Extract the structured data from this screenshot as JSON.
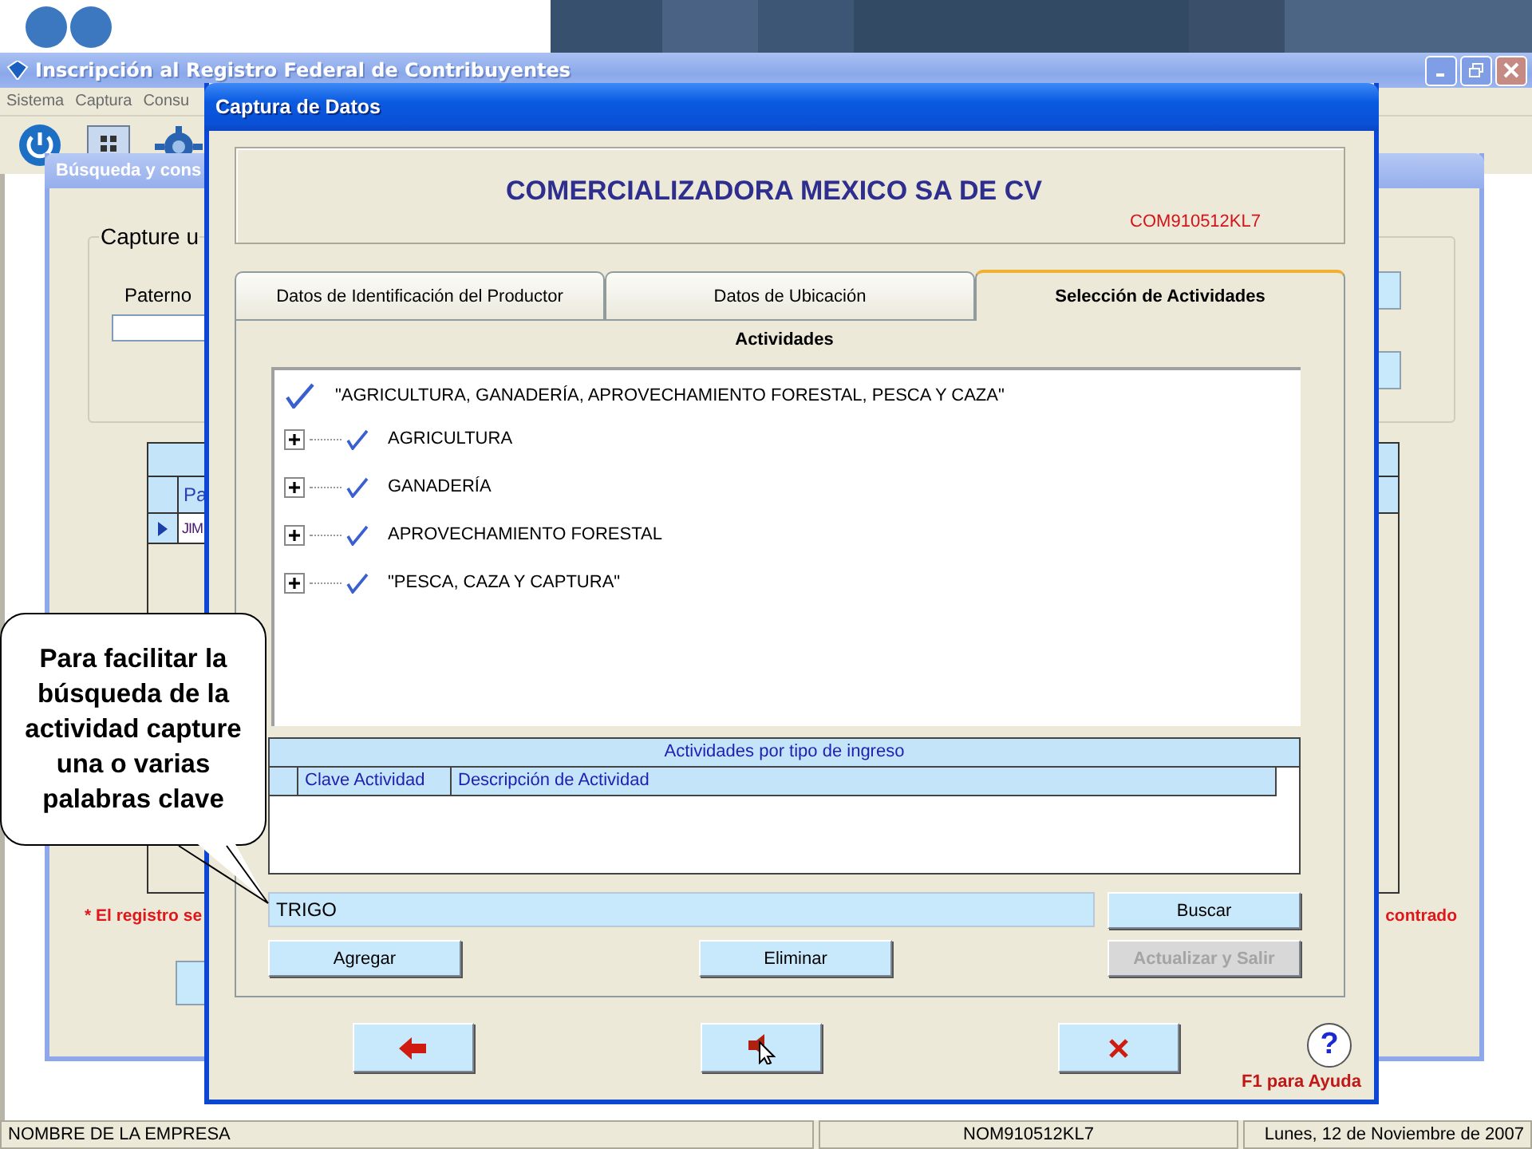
{
  "banner": {
    "kind": "logo"
  },
  "main_window": {
    "title": "Inscripción al Registro Federal de Contribuyentes",
    "menu": [
      "Sistema",
      "Captura",
      "Consu"
    ],
    "status_bar": [
      "NOMBRE DE LA EMPRESA",
      "NOM910512KL7",
      "Lunes, 12 de Noviembre de 2007"
    ]
  },
  "search_dialog": {
    "title": "Búsqueda y cons",
    "group_label": "Capture u",
    "field_label": "Paterno",
    "grid_header": "Pa",
    "grid_rows": [
      {
        "text": "JIM",
        "selected": true
      }
    ],
    "note": "* El registro se",
    "note_end": "contrado"
  },
  "capture_dialog": {
    "title": "Captura de Datos",
    "company_name": "COMERCIALIZADORA MEXICO SA DE CV",
    "rfc": "COM910512KL7",
    "tabs": [
      {
        "label": "Datos de Identificación del Productor",
        "selected": false
      },
      {
        "label": "Datos de Ubicación",
        "selected": false
      },
      {
        "label": "Selección de Actividades",
        "selected": true
      }
    ],
    "section_title": "Actividades",
    "tree": [
      {
        "label": "\"AGRICULTURA, GANADERÍA, APROVECHAMIENTO FORESTAL, PESCA Y CAZA\"",
        "checked": true,
        "children": [
          {
            "label": "AGRICULTURA",
            "checked": true,
            "expanded": false
          },
          {
            "label": "GANADERÍA",
            "checked": true,
            "expanded": false
          },
          {
            "label": "APROVECHAMIENTO FORESTAL",
            "checked": true,
            "expanded": false
          },
          {
            "label": "\"PESCA, CAZA Y CAPTURA\"",
            "checked": true,
            "expanded": false
          }
        ]
      }
    ],
    "table": {
      "title": "Actividades por tipo de ingreso",
      "columns": [
        "Clave Actividad",
        "Descripción de Actividad"
      ]
    },
    "search": {
      "value": "TRIGO"
    },
    "search_button": {
      "label": "Buscar",
      "disabled": false
    },
    "buttons": [
      {
        "label": "Agregar",
        "disabled": false
      },
      {
        "label": "Eliminar",
        "disabled": false
      },
      {
        "label": "Actualizar y Salir",
        "disabled": true
      }
    ],
    "nav_buttons": [
      {
        "kind": "back"
      },
      {
        "kind": "pointer"
      },
      {
        "kind": "cancel"
      }
    ],
    "help": {
      "icon": "?",
      "text": "F1 para Ayuda"
    }
  },
  "callout": {
    "text": "Para facilitar la búsqueda de la actividad capture una o varias palabras clave"
  }
}
